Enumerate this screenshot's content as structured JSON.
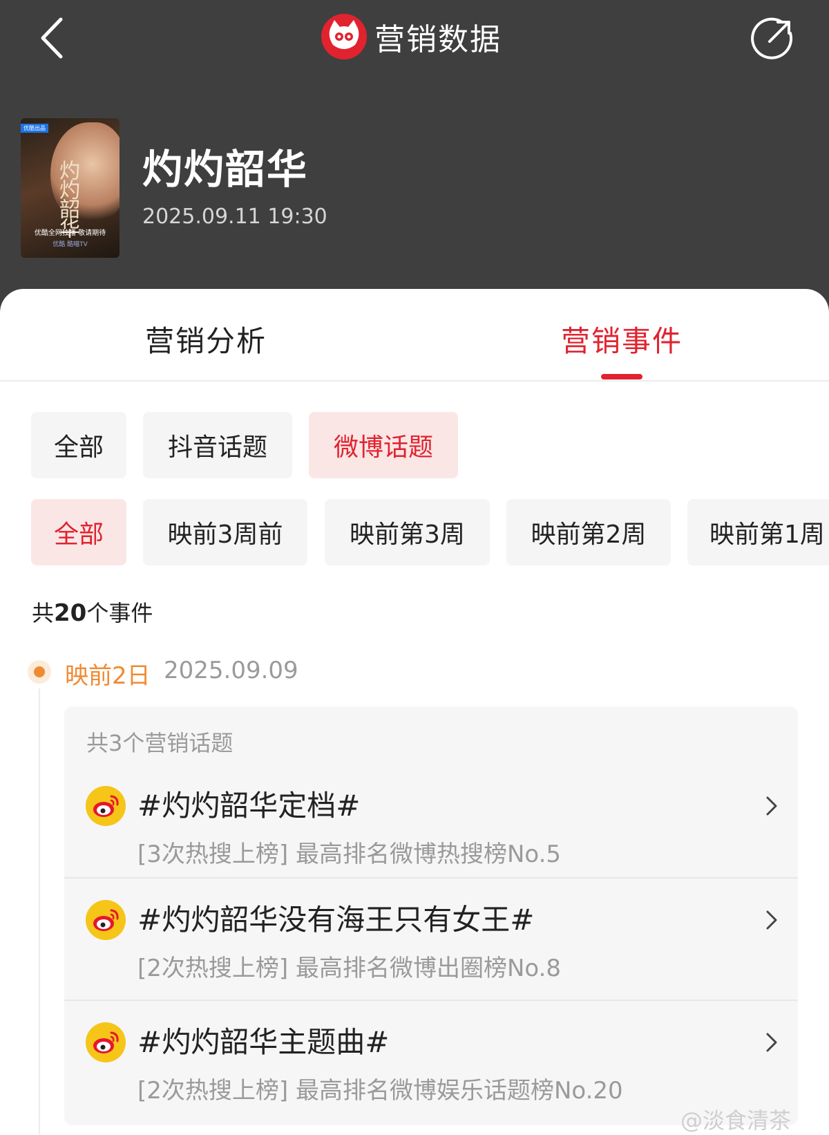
{
  "header": {
    "title": "营销数据",
    "back_icon": "chevron-left-icon",
    "share_icon": "share-icon",
    "logo_icon": "cat-eye-logo-icon"
  },
  "show": {
    "title": "灼灼韶华",
    "datetime": "2025.09.11 19:30",
    "poster": {
      "tag": "优酷出品",
      "title": "灼灼韶华",
      "footer": "优酷全网独播 敬请期待",
      "footer2": "优酷 酷喵TV"
    }
  },
  "tabs": [
    {
      "label": "营销分析",
      "active": false
    },
    {
      "label": "营销事件",
      "active": true
    }
  ],
  "filters": {
    "platform": [
      {
        "label": "全部",
        "active": false
      },
      {
        "label": "抖音话题",
        "active": false
      },
      {
        "label": "微博话题",
        "active": true
      }
    ],
    "period": [
      {
        "label": "全部",
        "active": true
      },
      {
        "label": "映前3周前",
        "active": false
      },
      {
        "label": "映前第3周",
        "active": false
      },
      {
        "label": "映前第2周",
        "active": false
      },
      {
        "label": "映前第1周",
        "active": false
      }
    ]
  },
  "summary": {
    "prefix": "共",
    "count": "20",
    "suffix": "个事件"
  },
  "timeline": {
    "label": "映前2日",
    "date": "2025.09.09",
    "subheader": "共3个营销话题",
    "events": [
      {
        "title": "#灼灼韶华定档#",
        "desc": "[3次热搜上榜] 最高排名微博热搜榜No.5",
        "icon": "weibo-icon"
      },
      {
        "title": "#灼灼韶华没有海王只有女王#",
        "desc": "[2次热搜上榜] 最高排名微博出圈榜No.8",
        "icon": "weibo-icon"
      },
      {
        "title": "#灼灼韶华主题曲#",
        "desc": "[2次热搜上榜] 最高排名微博娱乐话题榜No.20",
        "icon": "weibo-icon"
      }
    ]
  },
  "watermark": "@淡食清茶",
  "colors": {
    "accent": "#e0232f",
    "orange": "#f08a32",
    "header_bg": "#3f3f3f",
    "weibo_yellow": "#f5c518"
  }
}
